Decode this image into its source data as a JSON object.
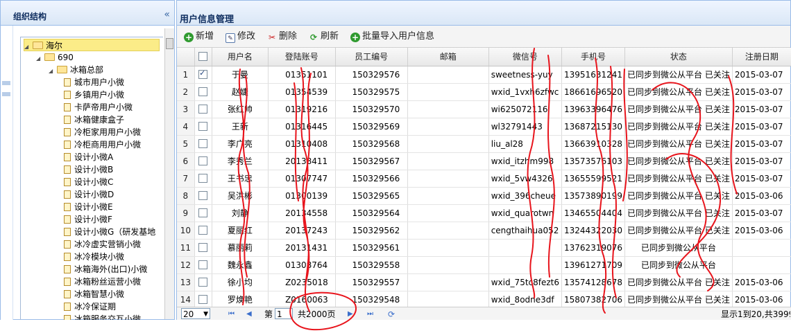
{
  "left_panel": {
    "title": "组织结构",
    "collapse_glyph": "«",
    "tree": [
      {
        "label": "海尔",
        "level": 0,
        "type": "folder",
        "expanded": true,
        "selected": true
      },
      {
        "label": "690",
        "level": 1,
        "type": "folder",
        "expanded": true
      },
      {
        "label": "冰箱总部",
        "level": 2,
        "type": "folder",
        "expanded": true
      },
      {
        "label": "城市用户小微",
        "level": 3,
        "type": "doc"
      },
      {
        "label": "乡镇用户小微",
        "level": 3,
        "type": "doc"
      },
      {
        "label": "卡萨帝用户小微",
        "level": 3,
        "type": "doc"
      },
      {
        "label": "冰箱健康盒子",
        "level": 3,
        "type": "doc"
      },
      {
        "label": "冷柜家用用户小微",
        "level": 3,
        "type": "doc"
      },
      {
        "label": "冷柜商用用户小微",
        "level": 3,
        "type": "doc"
      },
      {
        "label": "设计小微A",
        "level": 3,
        "type": "doc"
      },
      {
        "label": "设计小微B",
        "level": 3,
        "type": "doc"
      },
      {
        "label": "设计小微C",
        "level": 3,
        "type": "doc"
      },
      {
        "label": "设计小微D",
        "level": 3,
        "type": "doc"
      },
      {
        "label": "设计小微E",
        "level": 3,
        "type": "doc"
      },
      {
        "label": "设计小微F",
        "level": 3,
        "type": "doc"
      },
      {
        "label": "设计小微G（研发基地",
        "level": 3,
        "type": "doc"
      },
      {
        "label": "冰冷虚实营销小微",
        "level": 3,
        "type": "doc"
      },
      {
        "label": "冰冷模块小微",
        "level": 3,
        "type": "doc"
      },
      {
        "label": "冰箱海外(出口)小微",
        "level": 3,
        "type": "doc"
      },
      {
        "label": "冰箱粉丝运营小微",
        "level": 3,
        "type": "doc"
      },
      {
        "label": "冰箱智慧小微",
        "level": 3,
        "type": "doc"
      },
      {
        "label": "冰冷保证期",
        "level": 3,
        "type": "doc"
      },
      {
        "label": "冰箱服务交互小微",
        "level": 3,
        "type": "doc"
      }
    ]
  },
  "main_panel": {
    "title": "用户信息管理",
    "toolbar": [
      {
        "label": "新增",
        "icon": "add-icon"
      },
      {
        "label": "修改",
        "icon": "edit-icon"
      },
      {
        "label": "删除",
        "icon": "delete-icon"
      },
      {
        "label": "刷新",
        "icon": "refresh-icon"
      },
      {
        "label": "批量导入用户信息",
        "icon": "import-icon"
      }
    ],
    "columns": [
      "用户名",
      "登陆账号",
      "员工编号",
      "邮箱",
      "微信号",
      "手机号",
      "状态",
      "注册日期"
    ],
    "rows": [
      {
        "n": "1",
        "checked": true,
        "user": "于曼",
        "account": "01351101",
        "emp": "150329576",
        "email": "",
        "wechat": "sweetness-yuy",
        "phone": "13951631241",
        "status": "已同步到微公从平台 已关注",
        "date": "2015-03-07"
      },
      {
        "n": "2",
        "checked": false,
        "user": "赵婕",
        "account": "01354539",
        "emp": "150329575",
        "email": "",
        "wechat": "wxid_1vxh6zfwc",
        "phone": "18661696520",
        "status": "已同步到微公从平台 已关注",
        "date": "2015-03-07"
      },
      {
        "n": "3",
        "checked": false,
        "user": "张红帅",
        "account": "01319216",
        "emp": "150329570",
        "email": "",
        "wechat": "wi625072116",
        "phone": "13963396476",
        "status": "已同步到微公从平台 已关注",
        "date": "2015-03-07"
      },
      {
        "n": "4",
        "checked": false,
        "user": "王新",
        "account": "01316445",
        "emp": "150329569",
        "email": "",
        "wechat": "wl32791443",
        "phone": "13687215130",
        "status": "已同步到微公从平台 已关注",
        "date": "2015-03-07"
      },
      {
        "n": "5",
        "checked": false,
        "user": "李广亮",
        "account": "01310408",
        "emp": "150329568",
        "email": "",
        "wechat": "liu_al28",
        "phone": "13663910328",
        "status": "已同步到微公从平台 已关注",
        "date": "2015-03-07"
      },
      {
        "n": "6",
        "checked": false,
        "user": "李秀兰",
        "account": "20138411",
        "emp": "150329567",
        "email": "",
        "wechat": "wxid_itzhm998",
        "phone": "13573576103",
        "status": "已同步到微公从平台 已关注",
        "date": "2015-03-07"
      },
      {
        "n": "7",
        "checked": false,
        "user": "王书忠",
        "account": "01307747",
        "emp": "150329566",
        "email": "",
        "wechat": "wxid_5vw4326",
        "phone": "13655599521",
        "status": "已同步到微公从平台 已关注",
        "date": "2015-03-07"
      },
      {
        "n": "8",
        "checked": false,
        "user": "吴洪彬",
        "account": "01300139",
        "emp": "150329565",
        "email": "",
        "wechat": "wxid_396cheue",
        "phone": "13573890199",
        "status": "已同步到微公从平台 已关注",
        "date": "2015-03-06"
      },
      {
        "n": "9",
        "checked": false,
        "user": "刘静",
        "account": "20134558",
        "emp": "150329564",
        "email": "",
        "wechat": "wxid_quarotwn",
        "phone": "13465504404",
        "status": "已同步到微公从平台 已关注",
        "date": "2015-03-07"
      },
      {
        "n": "10",
        "checked": false,
        "user": "夏丽红",
        "account": "20137243",
        "emp": "150329562",
        "email": "",
        "wechat": "cengthaihua052",
        "phone": "13244322030",
        "status": "已同步到微公从平台 已关注",
        "date": "2015-03-06"
      },
      {
        "n": "11",
        "checked": false,
        "user": "慕丽莉",
        "account": "20131431",
        "emp": "150329561",
        "email": "",
        "wechat": "",
        "phone": "13762319076",
        "status": "已同步到微公从平台",
        "date": ""
      },
      {
        "n": "12",
        "checked": false,
        "user": "魏永鑫",
        "account": "01308764",
        "emp": "150329558",
        "email": "",
        "wechat": "",
        "phone": "13961271709",
        "status": "已同步到微公从平台",
        "date": ""
      },
      {
        "n": "13",
        "checked": false,
        "user": "徐小均",
        "account": "Z0235018",
        "emp": "150329557",
        "email": "",
        "wechat": "wxid_75tc8fezt6",
        "phone": "13574128678",
        "status": "已同步到微公从平台 已关注",
        "date": "2015-03-06"
      },
      {
        "n": "14",
        "checked": false,
        "user": "罗焕艳",
        "account": "Z0160063",
        "emp": "150329548",
        "email": "",
        "wechat": "wxid_8odne3df",
        "phone": "15807382706",
        "status": "已同步到微公从平台 已关注",
        "date": "2015-03-06"
      }
    ],
    "pager": {
      "page_size": "20",
      "page_label": "第",
      "page_value": "1",
      "total_pages": "共2000页",
      "summary": "显示1到20,共3999"
    }
  },
  "colors": {
    "accent_border": "#99bbe8",
    "header_bg": "#dae7f6",
    "scribble": "#e8141c",
    "selected_node": "#fbec88"
  }
}
